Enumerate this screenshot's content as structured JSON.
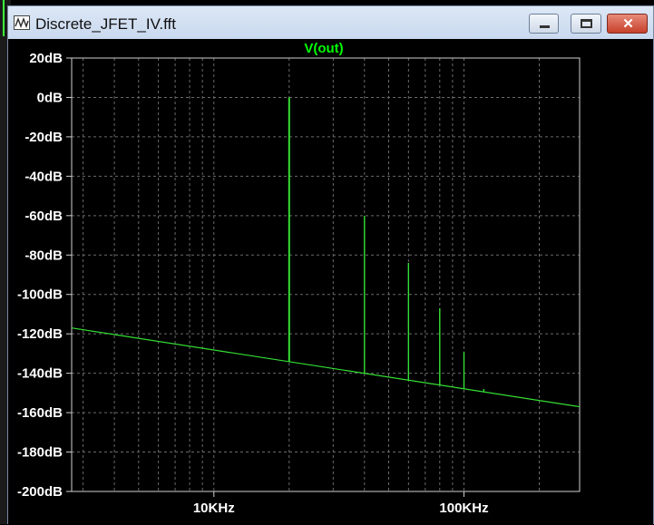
{
  "window": {
    "title": "Discrete_JFET_IV.fft",
    "close_glyph": "✕",
    "icons": [
      "app-waveform-icon",
      "minimize-icon",
      "maximize-icon",
      "close-icon"
    ]
  },
  "colors": {
    "trace": "#34e034",
    "title": "#00ff00",
    "grid": "#6a6a6a",
    "axis_text": "#ffffff",
    "background": "#000000",
    "frame": "#cfcfcf"
  },
  "chart_data": {
    "type": "line",
    "title": "V(out)",
    "xscale": "log",
    "xlim": [
      2700,
      290000
    ],
    "ylim": [
      -200,
      20
    ],
    "yunit": "dB",
    "x_tick_labels": [
      {
        "value": 10000,
        "label": "10KHz"
      },
      {
        "value": 100000,
        "label": "100KHz"
      }
    ],
    "y_ticks": [
      20,
      0,
      -20,
      -40,
      -60,
      -80,
      -100,
      -120,
      -140,
      -160,
      -180,
      -200
    ],
    "y_tick_labels": [
      "20dB",
      "0dB",
      "-20dB",
      "-40dB",
      "-60dB",
      "-80dB",
      "-100dB",
      "-120dB",
      "-140dB",
      "-160dB",
      "-180dB",
      "-200dB"
    ],
    "grid": true,
    "noise_floor": {
      "x": [
        2700,
        290000
      ],
      "y": [
        -117,
        -157
      ]
    },
    "harmonics": [
      {
        "x": 20000,
        "y": 0
      },
      {
        "x": 40000,
        "y": -60
      },
      {
        "x": 60000,
        "y": -84
      },
      {
        "x": 80000,
        "y": -107
      },
      {
        "x": 100000,
        "y": -129
      },
      {
        "x": 120000,
        "y": -148
      }
    ]
  }
}
